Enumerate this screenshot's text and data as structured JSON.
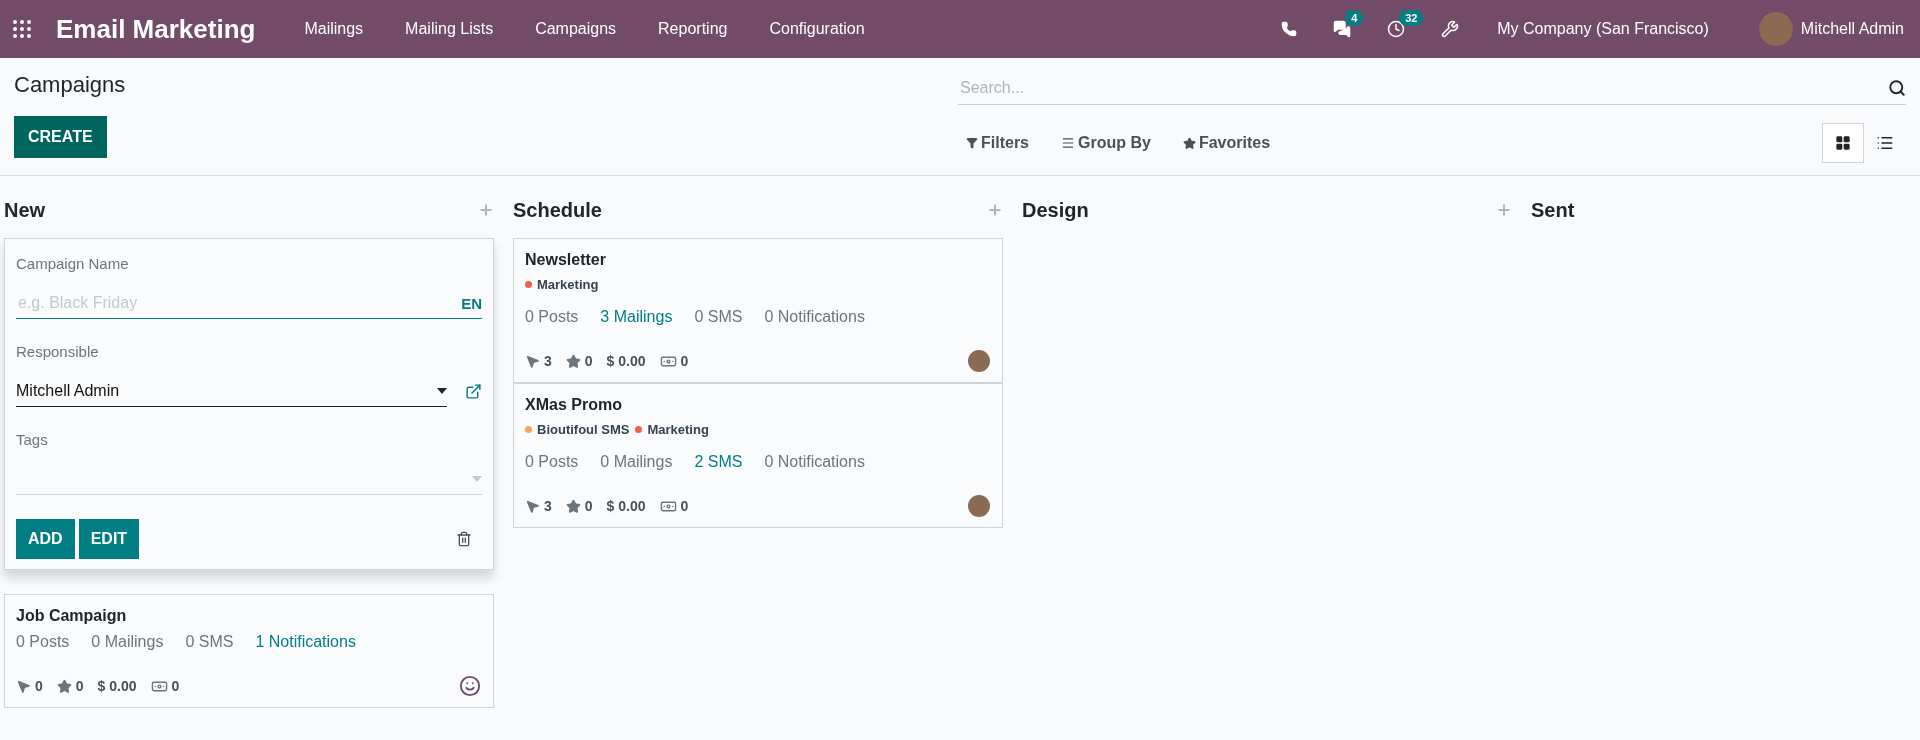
{
  "navbar": {
    "app_title": "Email Marketing",
    "menu": [
      "Mailings",
      "Mailing Lists",
      "Campaigns",
      "Reporting",
      "Configuration"
    ],
    "chat_badge": "4",
    "activity_badge": "32",
    "company": "My Company (San Francisco)",
    "user": "Mitchell Admin"
  },
  "control_panel": {
    "title": "Campaigns",
    "create_button": "CREATE",
    "search": {
      "placeholder": "Search..."
    },
    "filters": "Filters",
    "group_by": "Group By",
    "favorites": "Favorites",
    "views": [
      {
        "kind": "kanban",
        "selected": true
      },
      {
        "kind": "list",
        "selected": false
      }
    ]
  },
  "columns": [
    {
      "title": "New",
      "show_add": true,
      "quick_create": {
        "name_label": "Campaign Name",
        "name_placeholder": "e.g. Black Friday",
        "lang": "EN",
        "responsible_label": "Responsible",
        "responsible_value": "Mitchell Admin",
        "tags_label": "Tags",
        "add_button": "ADD",
        "edit_button": "EDIT"
      },
      "cards": [
        {
          "title": "Job Campaign",
          "counts": [
            {
              "text": "0 Posts",
              "highlighted": false
            },
            {
              "text": "0 Mailings",
              "highlighted": false
            },
            {
              "text": "0 SMS",
              "highlighted": false
            },
            {
              "text": "1 Notifications",
              "highlighted": true
            }
          ],
          "stats": [
            {
              "kind": "clicks",
              "value": "0"
            },
            {
              "kind": "stars",
              "value": "0"
            },
            {
              "kind": "revenue",
              "value": "$ 0.00"
            },
            {
              "kind": "money",
              "value": "0"
            }
          ],
          "has_avatar": false
        }
      ]
    },
    {
      "title": "Schedule",
      "show_add": true,
      "cards": [
        {
          "title": "Newsletter",
          "tags": [
            {
              "label": "Marketing",
              "color": "#f06050"
            }
          ],
          "counts": [
            {
              "text": "0 Posts",
              "highlighted": false
            },
            {
              "text": "3 Mailings",
              "highlighted": true
            },
            {
              "text": "0 SMS",
              "highlighted": false
            },
            {
              "text": "0 Notifications",
              "highlighted": false
            }
          ],
          "stats": [
            {
              "kind": "clicks",
              "value": "3"
            },
            {
              "kind": "stars",
              "value": "0"
            },
            {
              "kind": "revenue",
              "value": "$ 0.00"
            },
            {
              "kind": "money",
              "value": "0"
            }
          ],
          "has_avatar": true
        },
        {
          "title": "XMas Promo",
          "tags": [
            {
              "label": "Bioutifoul SMS",
              "color": "#f4a460"
            },
            {
              "label": "Marketing",
              "color": "#f06050"
            }
          ],
          "counts": [
            {
              "text": "0 Posts",
              "highlighted": false
            },
            {
              "text": "0 Mailings",
              "highlighted": false
            },
            {
              "text": "2 SMS",
              "highlighted": true
            },
            {
              "text": "0 Notifications",
              "highlighted": false
            }
          ],
          "stats": [
            {
              "kind": "clicks",
              "value": "3"
            },
            {
              "kind": "stars",
              "value": "0"
            },
            {
              "kind": "revenue",
              "value": "$ 0.00"
            },
            {
              "kind": "money",
              "value": "0"
            }
          ],
          "has_avatar": true
        }
      ]
    },
    {
      "title": "Design",
      "show_add": true
    },
    {
      "title": "Sent",
      "show_add": false
    }
  ]
}
